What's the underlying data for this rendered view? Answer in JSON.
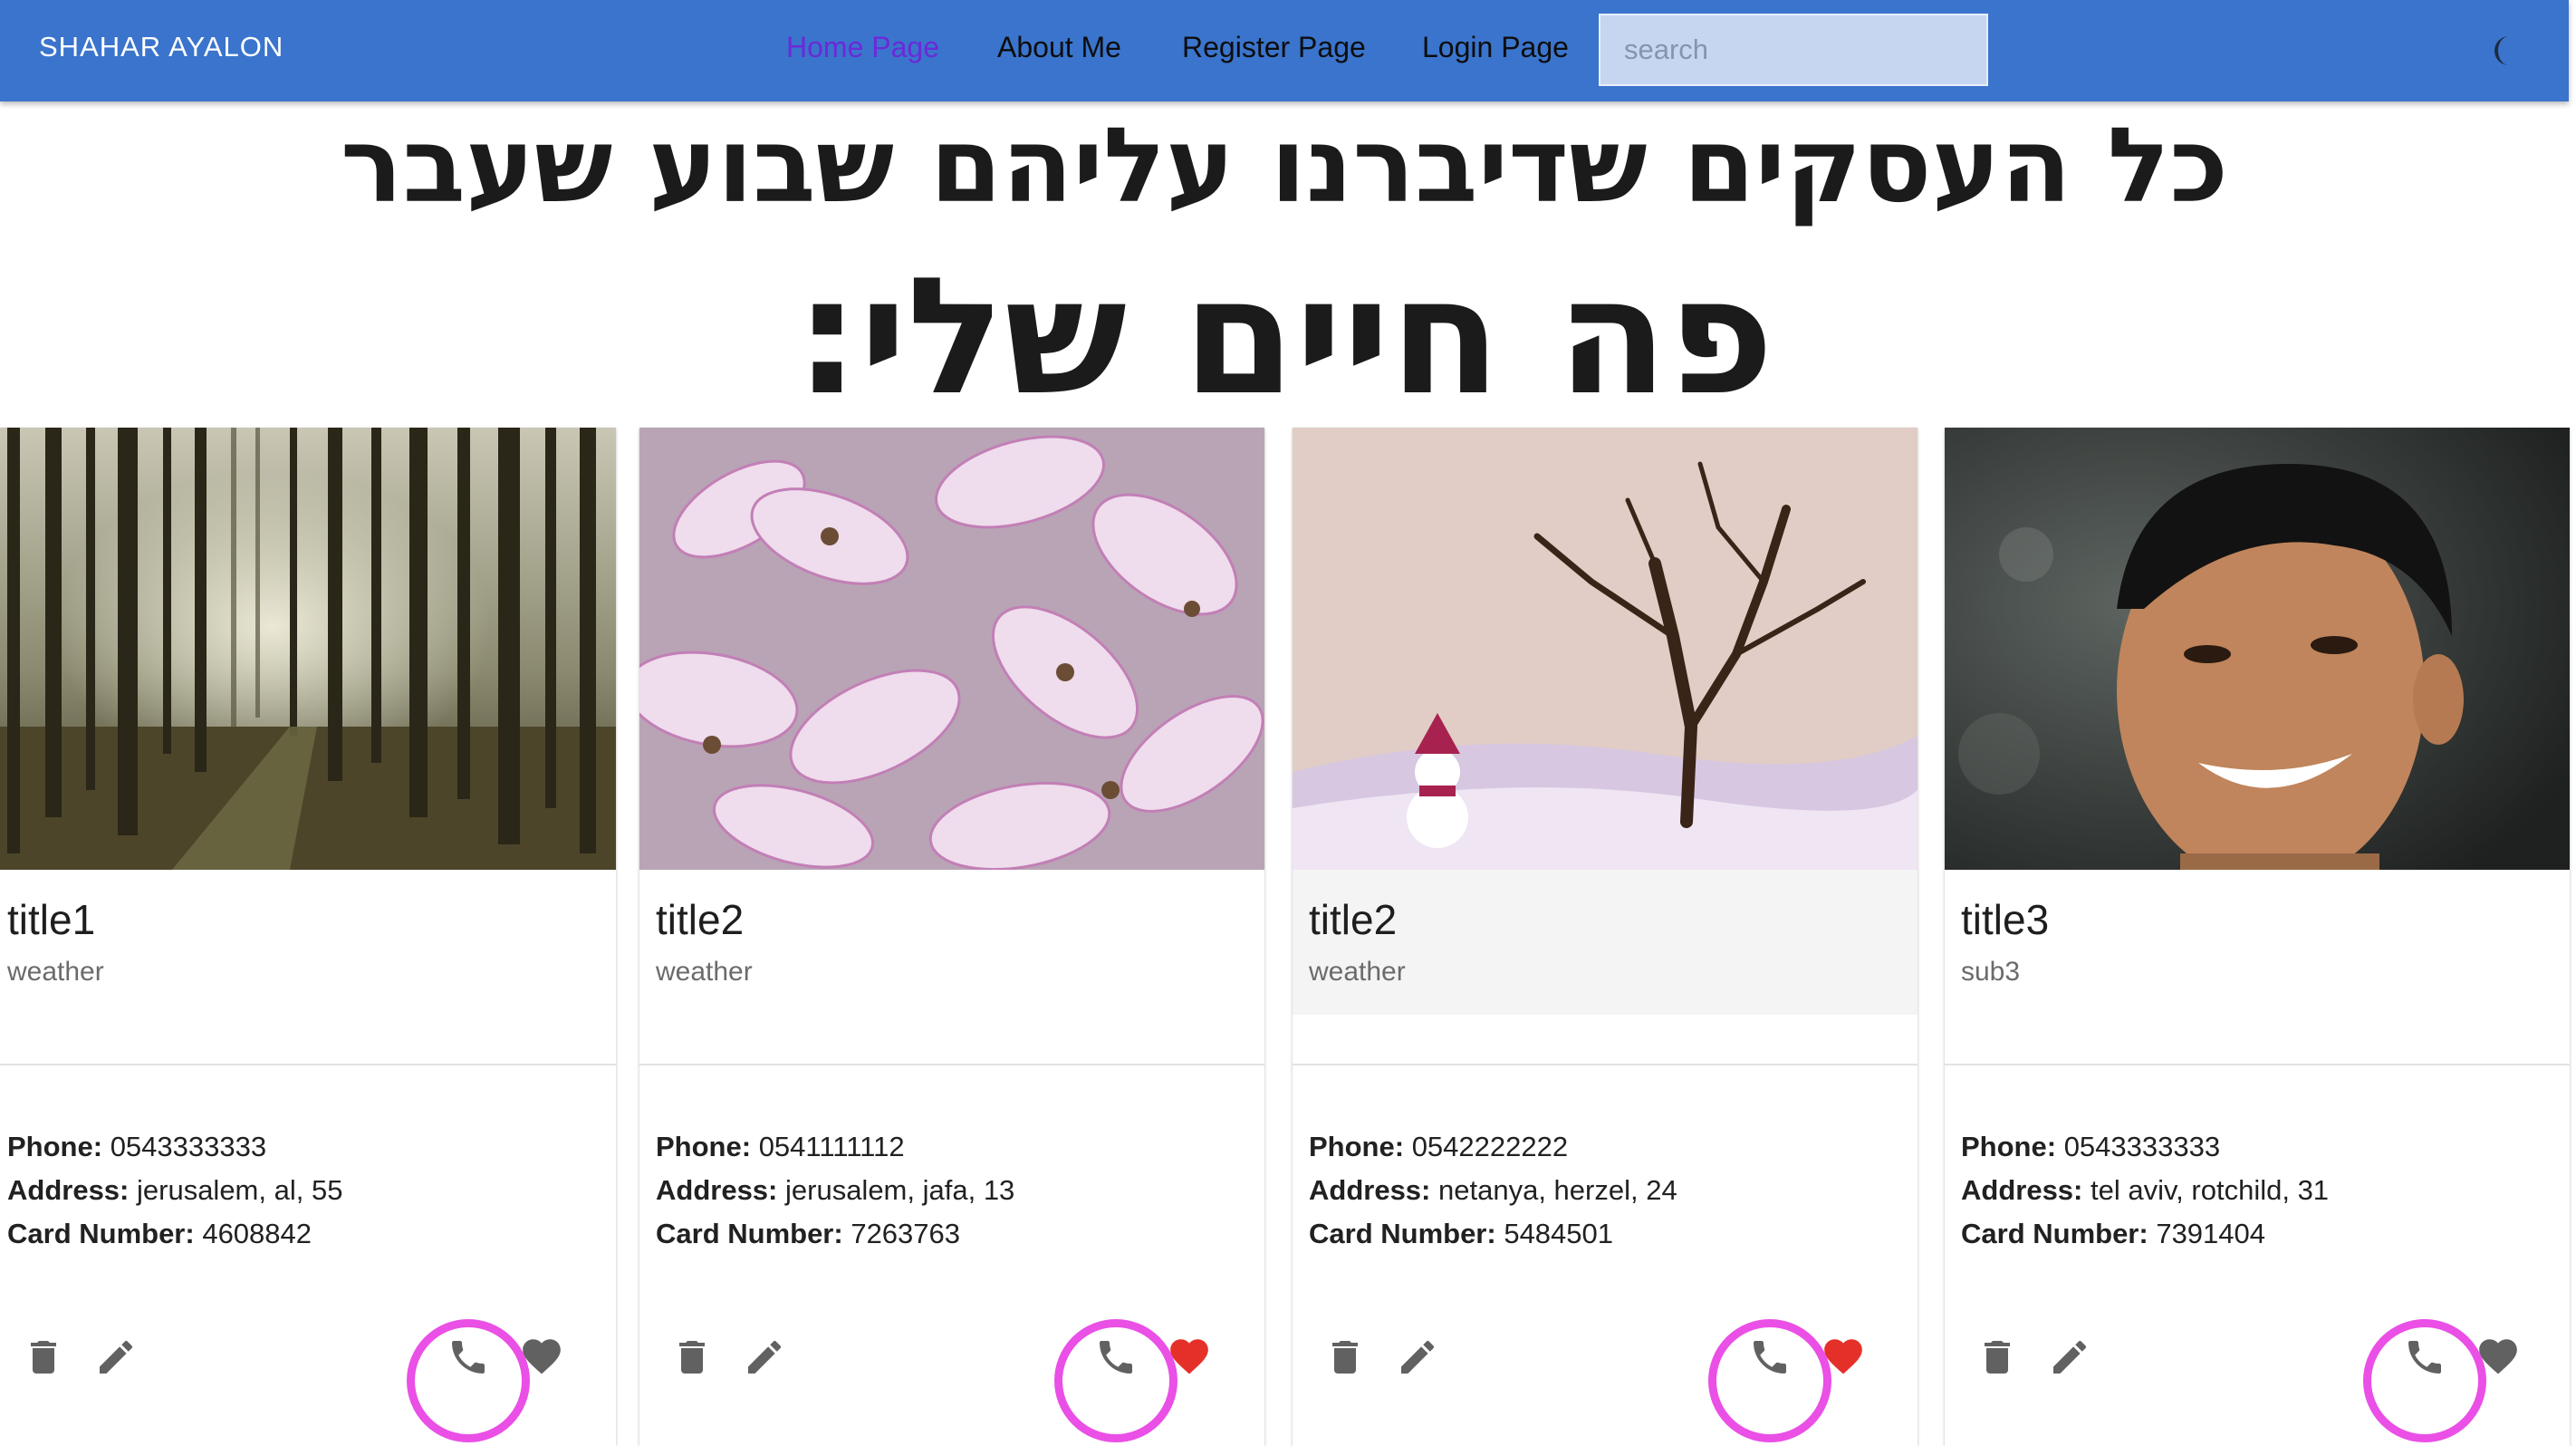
{
  "appbar": {
    "brand": "SHAHAR AYALON",
    "nav": [
      {
        "label": "Home Page",
        "active": true
      },
      {
        "label": "About Me",
        "active": false
      },
      {
        "label": "Register Page",
        "active": false
      },
      {
        "label": "Login Page",
        "active": false
      }
    ],
    "search_placeholder": "search",
    "theme_icon": "dark-mode-moon-icon"
  },
  "headings": {
    "line1": "כל העסקים שדיברנו עליהם שבוע שעבר",
    "line2": "פה חיים שלי:"
  },
  "labels": {
    "phone": "Phone:",
    "address": "Address:",
    "card_number": "Card Number:"
  },
  "cards": [
    {
      "image": "forest-photo",
      "title": "title1",
      "subtitle": "weather",
      "phone": "0543333333",
      "address": "jerusalem, al, 55",
      "card_number": "4608842",
      "favorite": false,
      "highlighted": false
    },
    {
      "image": "pink-flowers-photo",
      "title": "title2",
      "subtitle": "weather",
      "phone": "0541111112",
      "address": "jerusalem, jafa, 13",
      "card_number": "7263763",
      "favorite": true,
      "highlighted": false
    },
    {
      "image": "snowman-tree-illustration",
      "title": "title2",
      "subtitle": "weather",
      "phone": "0542222222",
      "address": "netanya, herzel, 24",
      "card_number": "5484501",
      "favorite": true,
      "highlighted": true
    },
    {
      "image": "smiling-boy-photo",
      "title": "title3",
      "subtitle": "sub3",
      "phone": "0543333333",
      "address": "tel aviv, rotchild, 31",
      "card_number": "7391404",
      "favorite": false,
      "highlighted": false
    }
  ],
  "colors": {
    "appbar": "#3a74cc",
    "active_nav": "#6d28d9",
    "favorite_on": "#e5302a",
    "favorite_off": "#616161",
    "action_icon": "#616161",
    "annotation_ring": "#ea4fe6"
  }
}
